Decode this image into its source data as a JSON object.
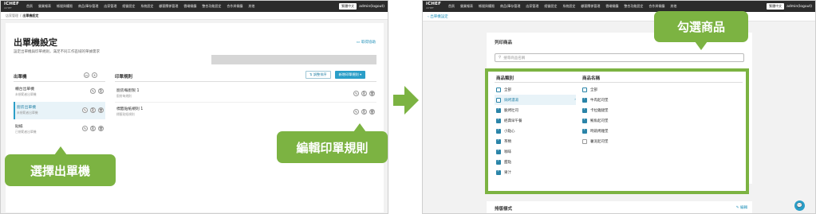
{
  "nav": {
    "logo": "iCHEF",
    "logo_sub": "iCHEF",
    "items": [
      "首頁",
      "營業報表",
      "帳號與權限",
      "商品/庫存管理",
      "店家管理",
      "經營設定",
      "系統設定",
      "顧客關係管理",
      "雲端餐廳",
      "整合功能設定",
      "合作與餐廳",
      "其他"
    ],
    "lang": "繁體中文",
    "admin": "admin(logout)"
  },
  "left": {
    "breadcrumb_parent": "店家管理",
    "breadcrumb_current": "出單機設定",
    "title": "出單機設定",
    "subtitle": "設定出單機與印單規則，滿足不同工作區域的單據需求",
    "help_link": "取得協助",
    "printers_header": "出單機",
    "rules_header": "印單規則",
    "btn_adjust": "調整排序",
    "btn_add_rule": "新增印單規則",
    "printers": [
      {
        "name": "櫃台出單機",
        "sub": "未規範者出單機"
      },
      {
        "name": "廚房出單機",
        "sub": "未規範者出單機"
      },
      {
        "name": "貼紙",
        "sub": "已規範者出單機"
      }
    ],
    "rules": [
      {
        "name": "廚房每廚製 1",
        "sub": "廚房每規則"
      },
      {
        "name": "標籤貼紙規則 1",
        "sub": "標籤貼紙規則"
      }
    ],
    "callout_select_printer": "選擇出單機",
    "callout_edit_rule": "編輯印單規則"
  },
  "right": {
    "back_link": "出單機設定",
    "section_title": "列印商品",
    "search_placeholder": "搜尋商品名稱",
    "cat_header": "商品類別",
    "prod_header": "商品名稱",
    "categories": [
      {
        "label": "全部",
        "state": "partial"
      },
      {
        "label": "焗烤濃湯",
        "state": "partial"
      },
      {
        "label": "脆烤吐司",
        "state": "on"
      },
      {
        "label": "經典早午餐",
        "state": "on"
      },
      {
        "label": "小點心",
        "state": "on"
      },
      {
        "label": "茶類",
        "state": "on"
      },
      {
        "label": "咖啡",
        "state": "on"
      },
      {
        "label": "甜點",
        "state": "on"
      },
      {
        "label": "果汁",
        "state": "on"
      }
    ],
    "products": [
      {
        "label": "全部",
        "state": "partial"
      },
      {
        "label": "牛肉起司堡",
        "state": "on"
      },
      {
        "label": "卡拉雞腿堡",
        "state": "on"
      },
      {
        "label": "鮪魚起司堡",
        "state": "on"
      },
      {
        "label": "時蔬烤雞堡",
        "state": "on"
      },
      {
        "label": "薯泥起司堡",
        "state": "off"
      }
    ],
    "bottom_title": "排版樣式",
    "bottom_link": "編輯",
    "callout_select_products": "勾選商品"
  },
  "colors": {
    "accent_green": "#7cb342",
    "accent_blue": "#2a9ec8",
    "topbar": "#2b2b2b"
  }
}
